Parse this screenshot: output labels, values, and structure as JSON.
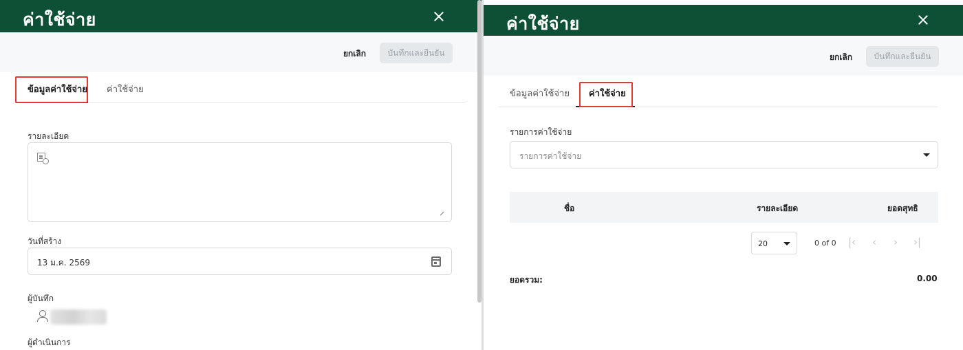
{
  "left_panel": {
    "title": "ค่าใช้จ่าย",
    "actions": {
      "cancel": "ยกเลิก",
      "save": "บันทึกและยืนยัน"
    },
    "tabs": [
      {
        "label": "ข้อมูลค่าใช้จ่าย",
        "active": true
      },
      {
        "label": "ค่าใช้จ่าย",
        "active": false
      }
    ],
    "form": {
      "detail_label": "รายละเอียด",
      "detail_value": "",
      "created_date_label": "วันที่สร้าง",
      "created_date_value": "13 ม.ค. 2569",
      "recorder_label": "ผู้บันทึก",
      "operator_label": "ผู้ดำเนินการ"
    }
  },
  "right_panel": {
    "title": "ค่าใช้จ่าย",
    "actions": {
      "cancel": "ยกเลิก",
      "save": "บันทึกและยืนยัน"
    },
    "tabs": [
      {
        "label": "ข้อมูลค่าใช้จ่าย",
        "active": false
      },
      {
        "label": "ค่าใช้จ่าย",
        "active": true
      }
    ],
    "expense_list": {
      "label": "รายการค่าใช้จ่าย",
      "placeholder": "รายการค่าใช้จ่าย"
    },
    "table": {
      "columns": [
        "ชื่อ",
        "รายละเอียด",
        "ยอดสุทธิ"
      ],
      "rows": []
    },
    "pagination": {
      "page_size": "20",
      "info": "0 of 0"
    },
    "summary": {
      "label": "ยอดรวม:",
      "value": "0.00"
    }
  },
  "colors": {
    "header": "#0e5036",
    "highlight": "#e53935",
    "disabled_button": "#e5e8eb"
  },
  "icons": [
    "close-icon",
    "document-icon",
    "calendar-icon",
    "user-icon",
    "caret-down-icon",
    "first-page-icon",
    "prev-page-icon",
    "next-page-icon",
    "last-page-icon"
  ]
}
